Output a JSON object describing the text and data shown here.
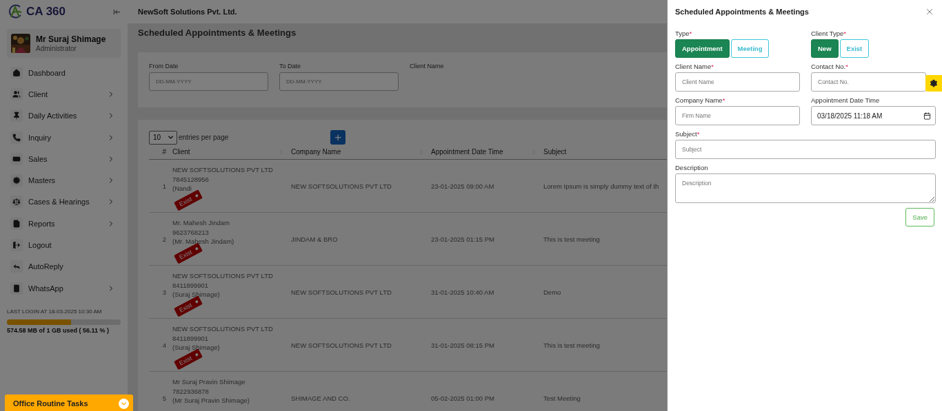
{
  "sidebar": {
    "logo": "CA 360",
    "user": {
      "name": "Mr Suraj Shimage",
      "role": "Administrator"
    },
    "menu": [
      {
        "label": "Dashboard",
        "has_submenu": false
      },
      {
        "label": "Client",
        "has_submenu": true
      },
      {
        "label": "Daily Activities",
        "has_submenu": true
      },
      {
        "label": "Inquiry",
        "has_submenu": true
      },
      {
        "label": "Sales",
        "has_submenu": true
      },
      {
        "label": "Masters",
        "has_submenu": true
      },
      {
        "label": "Cases & Hearings",
        "has_submenu": true
      },
      {
        "label": "Reports",
        "has_submenu": true
      },
      {
        "label": "Logout",
        "has_submenu": false
      },
      {
        "label": "AutoReply",
        "has_submenu": false
      },
      {
        "label": "WhatsApp",
        "has_submenu": true
      }
    ],
    "last_login": "LAST LOGIN AT 18-03-2025 10:30 AM",
    "storage": {
      "level": 0.5611,
      "reading": "574.58 MB of 1 GB used ( 56.11 % )"
    }
  },
  "task_bar": {
    "label": "Office Routine Tasks"
  },
  "header": {
    "company": "NewSoft Solutions Pvt. Ltd."
  },
  "page_title": "Scheduled Appointments & Meetings",
  "filters": [
    {
      "label": "From Date",
      "placeholder": "DD-MM-YYYY"
    },
    {
      "label": "To Date",
      "placeholder": "DD-MM-YYYY"
    },
    {
      "label": "Client Name"
    }
  ],
  "table": {
    "page_size": "10",
    "page_size_label": "entries per page",
    "add_button": "+",
    "columns": [
      "#",
      "Client",
      "Company Name",
      "Appointment Date Time",
      "Subject"
    ],
    "rows": [
      {
        "index": "1",
        "client": [
          "NEW SOFTSOLUTIONS PVT LTD",
          "7845128956",
          "(Nandi"
        ],
        "tag": "Exist",
        "company": "NEW SOFTSOLUTIONS PVT LTD",
        "datetime": "23-01-2025 09:00 AM",
        "subject": "Lorem Ipsum is simply dummy text of th"
      },
      {
        "index": "2",
        "client": [
          "Mr. Mahesh Jindam",
          "9623768213",
          "(Mr. Mahesh Jindam)"
        ],
        "tag": "Exist",
        "company": "JINDAM & BRO",
        "datetime": "23-01-2025 01:15 PM",
        "subject": "This is test meeting"
      },
      {
        "index": "3",
        "client": [
          "NEW SOFTSOLUTIONS PVT LTD",
          "8411899901",
          "(Suraj Shimage)"
        ],
        "tag": "Exist",
        "company": "NEW SOFTSOLUTIONS PVT LTD",
        "datetime": "31-01-2025 10:40 AM",
        "subject": "Demo"
      },
      {
        "index": "4",
        "client": [
          "NEW SOFTSOLUTIONS PVT LTD",
          "8411899901",
          "(Suraj Shimage)"
        ],
        "tag": "Exist",
        "company": "NEW SOFTSOLUTIONS PVT LTD",
        "datetime": "31-01-2025 08:15 PM",
        "subject": "This is test meeting"
      },
      {
        "index": "5",
        "client": [
          "Mr Suraj Pravin Shimage",
          "7822936878",
          "(Mr Suraj Pravin Shimage)"
        ],
        "company": "SHIMAGE AND CO.",
        "datetime": "05-02-2025 01:00 PM",
        "subject": "Test Meeting"
      }
    ]
  },
  "drawer": {
    "title": "Scheduled Appointments & Meetings",
    "type": {
      "label": "Type",
      "required_mark": "*",
      "options": [
        {
          "label": "Appointment",
          "selected": true
        },
        {
          "label": "Meeting",
          "selected": false
        }
      ]
    },
    "client_type": {
      "label": "Client Type",
      "required_mark": "*",
      "options": [
        {
          "label": "New",
          "selected": true
        },
        {
          "label": "Exist",
          "selected": false
        }
      ]
    },
    "fields": [
      {
        "label": "Client Name",
        "required_mark": "*",
        "placeholder": "Client Name",
        "kind": "text"
      },
      {
        "label": "Contact No.",
        "required_mark": "*",
        "placeholder": "Contact No.",
        "kind": "text"
      },
      {
        "label": "Company Name",
        "required_mark": "*",
        "placeholder": "Firm Name",
        "kind": "text"
      },
      {
        "label": "Appointment Date Time",
        "value": "03/18/2025 11:18 AM",
        "kind": "datetime"
      },
      {
        "label": "Subject",
        "required_mark": "*",
        "placeholder": "Subject",
        "kind": "wide"
      },
      {
        "label": "Description",
        "placeholder": "Description",
        "kind": "textarea"
      }
    ],
    "save": "Save"
  }
}
